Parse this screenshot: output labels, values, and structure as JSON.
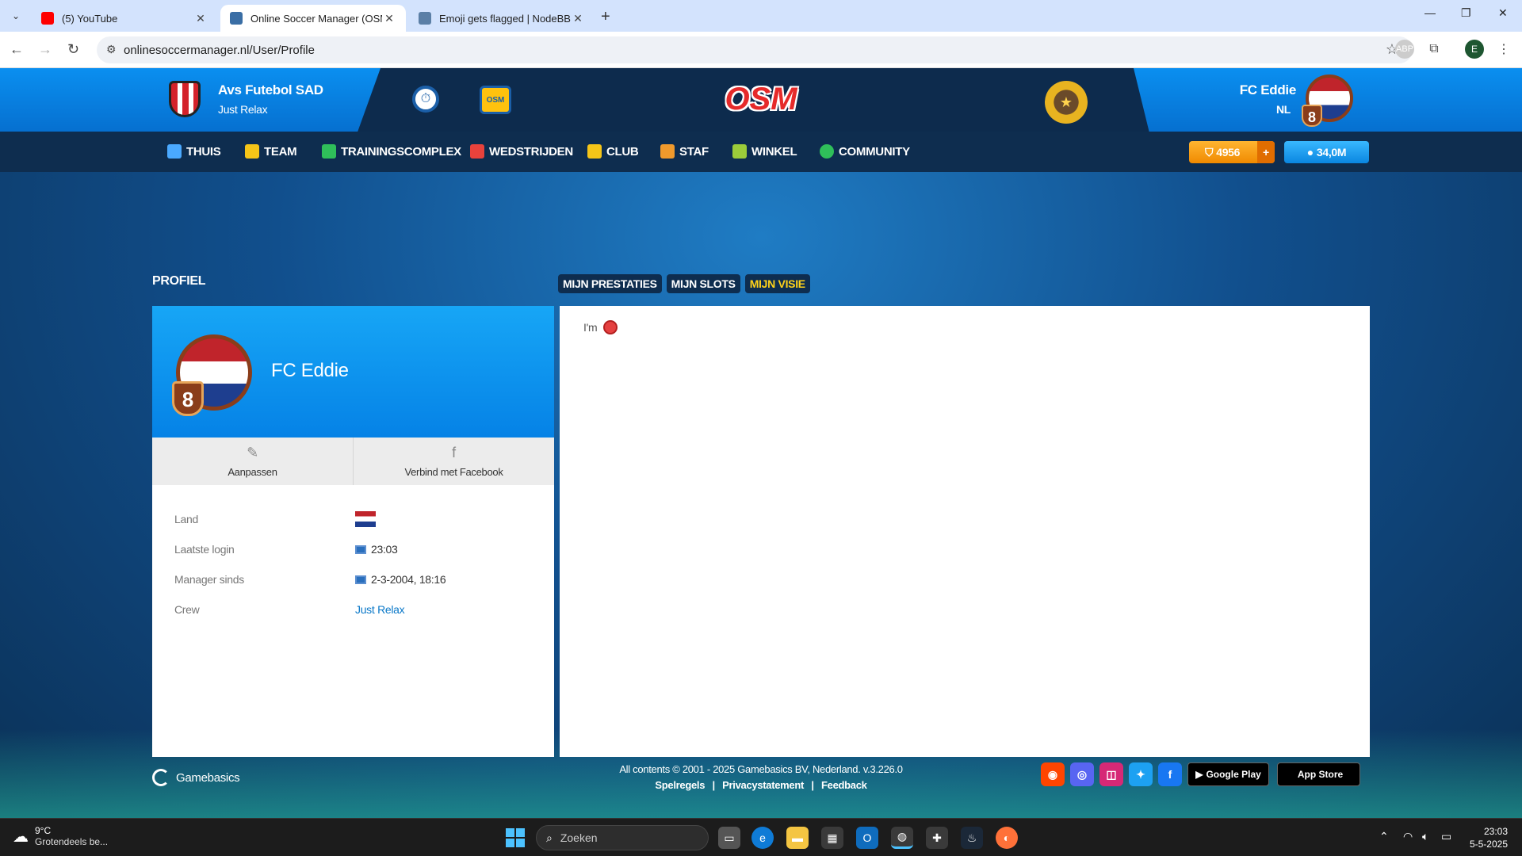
{
  "browser": {
    "tabs": [
      {
        "title": "(5) YouTube",
        "favicon_color": "#ff0000",
        "active": false
      },
      {
        "title": "Online Soccer Manager (OSM)",
        "favicon_color": "#3a6ea5",
        "active": true
      },
      {
        "title": "Emoji gets flagged | NodeBB",
        "favicon_color": "#5b7fa6",
        "active": false
      }
    ],
    "url": "onlinesoccermanager.nl/User/Profile",
    "profile_initial": "E"
  },
  "header": {
    "club_name": "Avs Futebol SAD",
    "club_subtitle": "Just Relax",
    "logo_text": "OSM",
    "osm_box_text": "OSM",
    "manager_name": "FC Eddie",
    "manager_nationality": "NL",
    "manager_level": "8"
  },
  "menu": {
    "items": [
      {
        "label": "THUIS",
        "icon": "home-icon"
      },
      {
        "label": "TEAM",
        "icon": "shirt-icon"
      },
      {
        "label": "TRAININGSCOMPLEX",
        "icon": "training-icon"
      },
      {
        "label": "WEDSTRIJDEN",
        "icon": "calendar-icon"
      },
      {
        "label": "CLUB",
        "icon": "club-shield-icon"
      },
      {
        "label": "STAF",
        "icon": "staff-icon"
      },
      {
        "label": "WINKEL",
        "icon": "shop-icon"
      },
      {
        "label": "COMMUNITY",
        "icon": "globe-icon"
      }
    ],
    "coins": "4956",
    "coins_plus": "+",
    "cash": "34,0M"
  },
  "page": {
    "title": "PROFIEL",
    "tabs": [
      "MIJN PRESTATIES",
      "MIJN SLOTS",
      "MIJN VISIE"
    ],
    "selected_tab": "MIJN VISIE"
  },
  "profile": {
    "name": "FC Eddie",
    "level": "8",
    "actions": [
      {
        "label": "Aanpassen",
        "icon": "pencil-icon"
      },
      {
        "label": "Verbind met Facebook",
        "icon": "facebook-icon"
      }
    ],
    "fields": [
      {
        "key": "Land",
        "value": ""
      },
      {
        "key": "Laatste login",
        "value": "23:03"
      },
      {
        "key": "Manager sinds",
        "value": "2-3-2004, 18:16"
      },
      {
        "key": "Crew",
        "value": "Just Relax"
      }
    ]
  },
  "vision": {
    "text": "I'm"
  },
  "footer": {
    "brand": "Gamebasics",
    "copyright": "All contents © 2001 - 2025 Gamebasics BV, Nederland. v.3.226.0",
    "links": [
      "Spelregels",
      "Privacystatement",
      "Feedback"
    ],
    "link_separator": "|",
    "google_play": "Google Play",
    "app_store": "App Store"
  },
  "taskbar": {
    "temperature": "9°C",
    "weather_desc": "Grotendeels be...",
    "search_placeholder": "Zoeken",
    "time": "23:03",
    "date": "5-5-2025"
  }
}
